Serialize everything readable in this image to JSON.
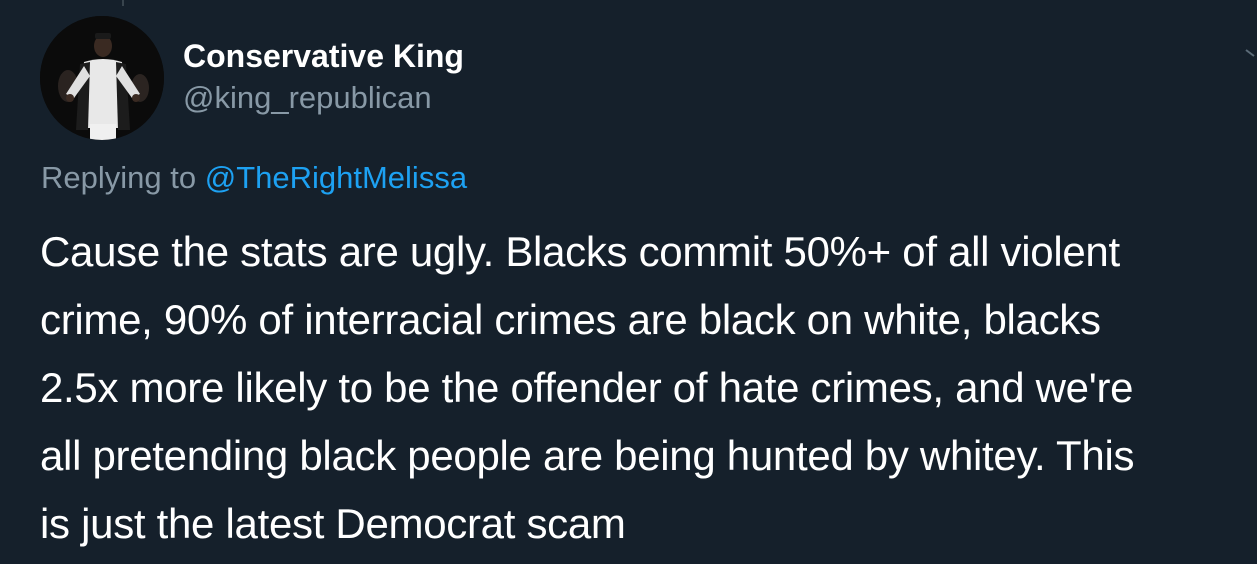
{
  "tweet": {
    "author": {
      "display_name": "Conservative King",
      "handle": "@king_republican",
      "avatar_icon": "profile-photo"
    },
    "reply_context": {
      "prefix": "Replying to",
      "mention": "@TheRightMelissa"
    },
    "text_lines": [
      "Cause the stats are ugly. Blacks commit 50%+ of all violent",
      "crime, 90% of interracial crimes are black on white, blacks",
      "2.5x more likely to be the offender of hate crimes, and we're",
      "all pretending black people are being hunted by whitey. This",
      "is just the latest Democrat scam"
    ],
    "menu_icon": "chevron-down-icon"
  },
  "colors": {
    "background": "#15202b",
    "primary_text": "#ffffff",
    "secondary_text": "#8899a6",
    "link": "#1da1f2"
  }
}
